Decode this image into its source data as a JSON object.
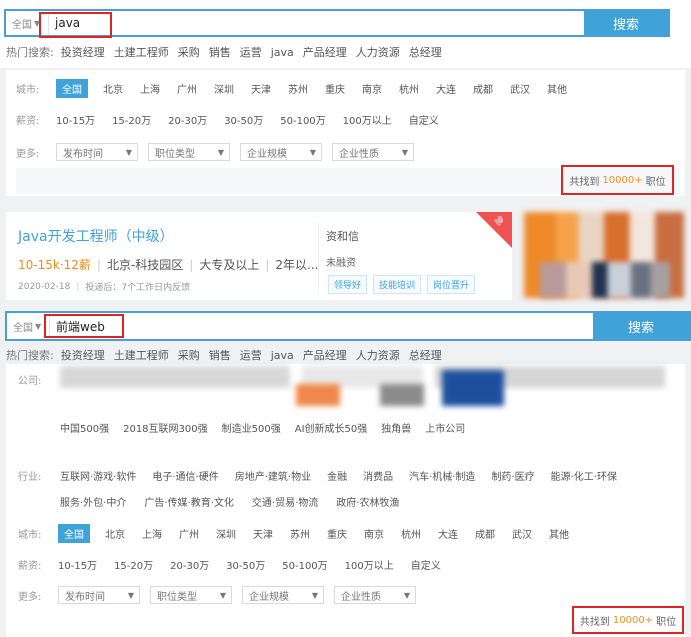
{
  "top": {
    "city": "全国",
    "query": "java",
    "search_label": "搜索",
    "hot_label": "热门搜索:",
    "hot_keywords": [
      "投资经理",
      "土建工程师",
      "采购",
      "销售",
      "运营",
      "java",
      "产品经理",
      "人力资源",
      "总经理"
    ],
    "filters": {
      "city_label": "城市:",
      "cities": [
        "全国",
        "北京",
        "上海",
        "广州",
        "深圳",
        "天津",
        "苏州",
        "重庆",
        "南京",
        "杭州",
        "大连",
        "成都",
        "武汉",
        "其他"
      ],
      "salary_label": "薪资:",
      "salaries": [
        "10-15万",
        "15-20万",
        "20-30万",
        "30-50万",
        "50-100万",
        "100万以上",
        "自定义"
      ],
      "more_label": "更多:",
      "dropdowns": [
        "发布时间",
        "职位类型",
        "企业规模",
        "企业性质"
      ]
    },
    "found": {
      "prefix": "共找到",
      "count": "10000+",
      "suffix": "职位"
    }
  },
  "job": {
    "title": "Java开发工程师（中级）",
    "salary": "10-15k·12薪",
    "location": "北京-科技园区",
    "education": "大专及以上",
    "experience": "2年以...",
    "date": "2020-02-18",
    "feedback": "投递后：7个工作日内反馈",
    "company": "资和信",
    "company_stage": "未融资",
    "tags": [
      "领导好",
      "技能培训",
      "岗位晋升"
    ],
    "badge": "急"
  },
  "bottom": {
    "city": "全国",
    "query": "前端web",
    "search_label": "搜索",
    "hot_label": "热门搜索:",
    "hot_keywords": [
      "投资经理",
      "土建工程师",
      "采购",
      "销售",
      "运营",
      "java",
      "产品经理",
      "人力资源",
      "总经理"
    ],
    "company_label": "公司:",
    "company_types": [
      "中国500强",
      "2018互联网300强",
      "制造业500强",
      "AI创新成长50强",
      "独角兽",
      "上市公司"
    ],
    "industry_label": "行业:",
    "industries_row1": [
      "互联网·游戏·软件",
      "电子·通信·硬件",
      "房地产·建筑·物业",
      "金融",
      "消费品",
      "汽车·机械·制造",
      "制药·医疗",
      "能源·化工·环保"
    ],
    "industries_row2": [
      "服务·外包·中介",
      "广告·传媒·教育·文化",
      "交通·贸易·物流",
      "政府·农林牧渔"
    ],
    "filters": {
      "city_label": "城市:",
      "cities": [
        "全国",
        "北京",
        "上海",
        "广州",
        "深圳",
        "天津",
        "苏州",
        "重庆",
        "南京",
        "杭州",
        "大连",
        "成都",
        "武汉",
        "其他"
      ],
      "salary_label": "薪资:",
      "salaries": [
        "10-15万",
        "15-20万",
        "20-30万",
        "30-50万",
        "50-100万",
        "100万以上",
        "自定义"
      ],
      "more_label": "更多:",
      "dropdowns": [
        "发布时间",
        "职位类型",
        "企业规模",
        "企业性质"
      ]
    },
    "found": {
      "prefix": "共找到",
      "count": "10000+",
      "suffix": "职位"
    }
  }
}
